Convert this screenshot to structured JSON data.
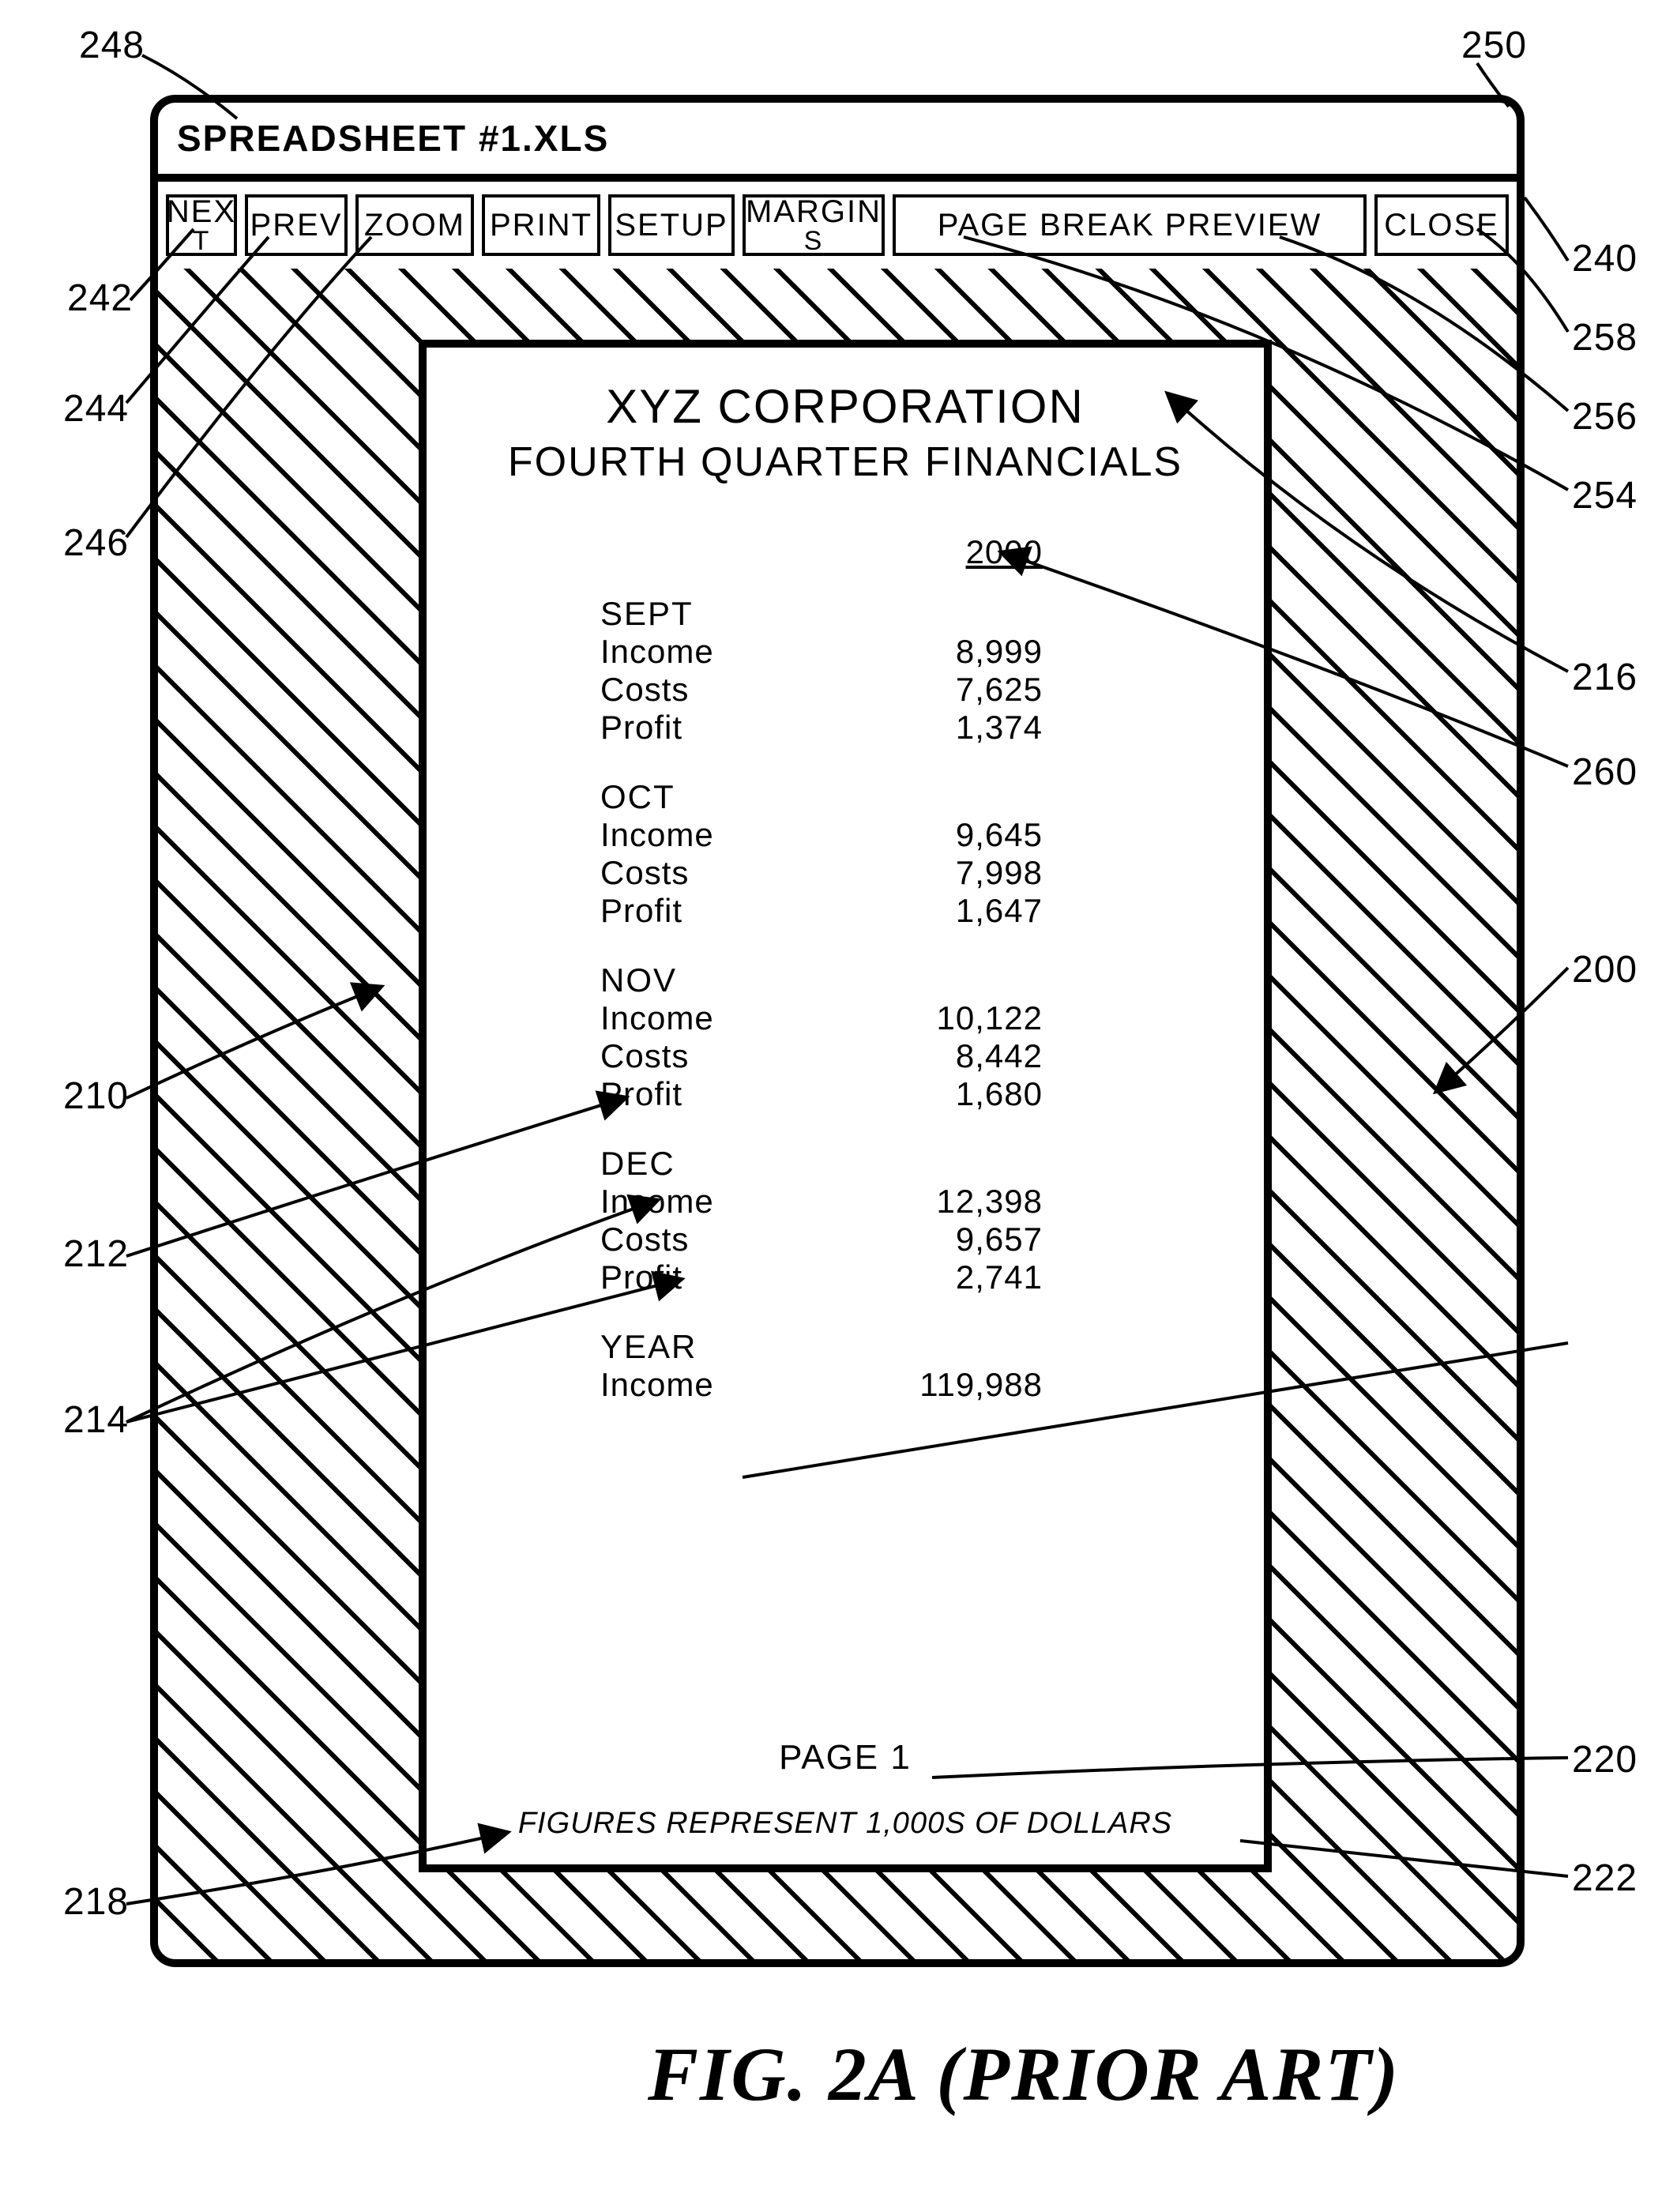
{
  "window": {
    "title": "SPREADSHEET #1.XLS"
  },
  "toolbar": {
    "next_top": "NEX",
    "next_bot": "T",
    "prev": "PREV",
    "zoom": "ZOOM",
    "print": "PRINT",
    "setup": "SETUP",
    "margin_top": "MARGIN",
    "margin_bot": "S",
    "pbp": "PAGE BREAK PREVIEW",
    "close": "CLOSE"
  },
  "report": {
    "title": "XYZ CORPORATION",
    "subtitle": "FOURTH QUARTER FINANCIALS",
    "year": "2000",
    "sections": [
      {
        "month": "SEPT",
        "rows": [
          {
            "label": "Income",
            "value": "8,999"
          },
          {
            "label": "Costs",
            "value": "7,625"
          },
          {
            "label": "Profit",
            "value": "1,374"
          }
        ]
      },
      {
        "month": "OCT",
        "rows": [
          {
            "label": "Income",
            "value": "9,645"
          },
          {
            "label": "Costs",
            "value": "7,998"
          },
          {
            "label": "Profit",
            "value": "1,647"
          }
        ]
      },
      {
        "month": "NOV",
        "rows": [
          {
            "label": "Income",
            "value": "10,122"
          },
          {
            "label": "Costs",
            "value": "8,442"
          },
          {
            "label": "Profit",
            "value": "1,680"
          }
        ]
      },
      {
        "month": "DEC",
        "rows": [
          {
            "label": "Income",
            "value": "12,398"
          },
          {
            "label": "Costs",
            "value": "9,657"
          },
          {
            "label": "Profit",
            "value": "2,741"
          }
        ]
      },
      {
        "month": "YEAR",
        "rows": [
          {
            "label": "Income",
            "value": "119,988"
          }
        ]
      }
    ],
    "page_number": "PAGE 1",
    "footnote": "FIGURES REPRESENT 1,000S OF DOLLARS"
  },
  "figure": {
    "caption": "FIG. 2A (PRIOR ART)"
  },
  "callouts": {
    "c248": "248",
    "c250": "250",
    "c242": "242",
    "c244": "244",
    "c246": "246",
    "c240": "240",
    "c258": "258",
    "c256": "256",
    "c254": "254",
    "c210": "210",
    "c212": "212",
    "c214": "214",
    "c216": "216",
    "c260": "260",
    "c200": "200",
    "c218": "218",
    "c220": "220",
    "c222": "222"
  }
}
